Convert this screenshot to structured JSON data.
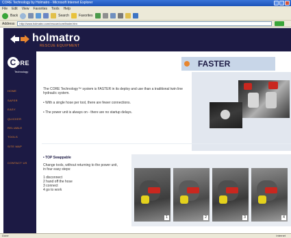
{
  "window": {
    "title": "CORE Technology by Holmatro - Microsoft Internet Explorer",
    "menu": [
      "File",
      "Edit",
      "View",
      "Favorites",
      "Tools",
      "Help"
    ],
    "toolbar": {
      "back_label": "Back",
      "search_label": "Search",
      "favorites_label": "Favorites"
    },
    "address_label": "Address",
    "address_value": "http://www.holmatro.com/rescue/core/faster.htm",
    "status_text": "Done",
    "status_zone": "Internet"
  },
  "header": {
    "brand": "holmatro",
    "tagline": "RESCUE EQUIPMENT"
  },
  "sidebar": {
    "core_logo": {
      "text": "ORE",
      "sub": "Technology"
    },
    "nav": [
      "HOME",
      "SAFER",
      "EASY",
      "QUICKER",
      "RELIABLE",
      "TOOLS",
      "SITE MAP",
      "CONTACT US"
    ]
  },
  "main": {
    "heading": "FASTER",
    "intro": "The CORE Technology™ system is FASTER in its deploy and use than a traditional twin line hydraulic system.",
    "bullets": [
      "With a single hose per tool, there are fewer connections.",
      "The power unit is always on - there are no startup delays."
    ],
    "lower_heading": "• TOP Swappable",
    "lower_intro": "Change tools, without returning to the power unit, in four easy steps:",
    "steps": [
      "1 disconnect",
      "2 hand off the hose",
      "3 connect",
      "4 go to work"
    ],
    "thumbs": [
      "1",
      "2",
      "3",
      "4"
    ]
  },
  "colors": {
    "navy": "#1c1a44",
    "accent": "#e8862f",
    "panel": "#c8d6e8"
  }
}
